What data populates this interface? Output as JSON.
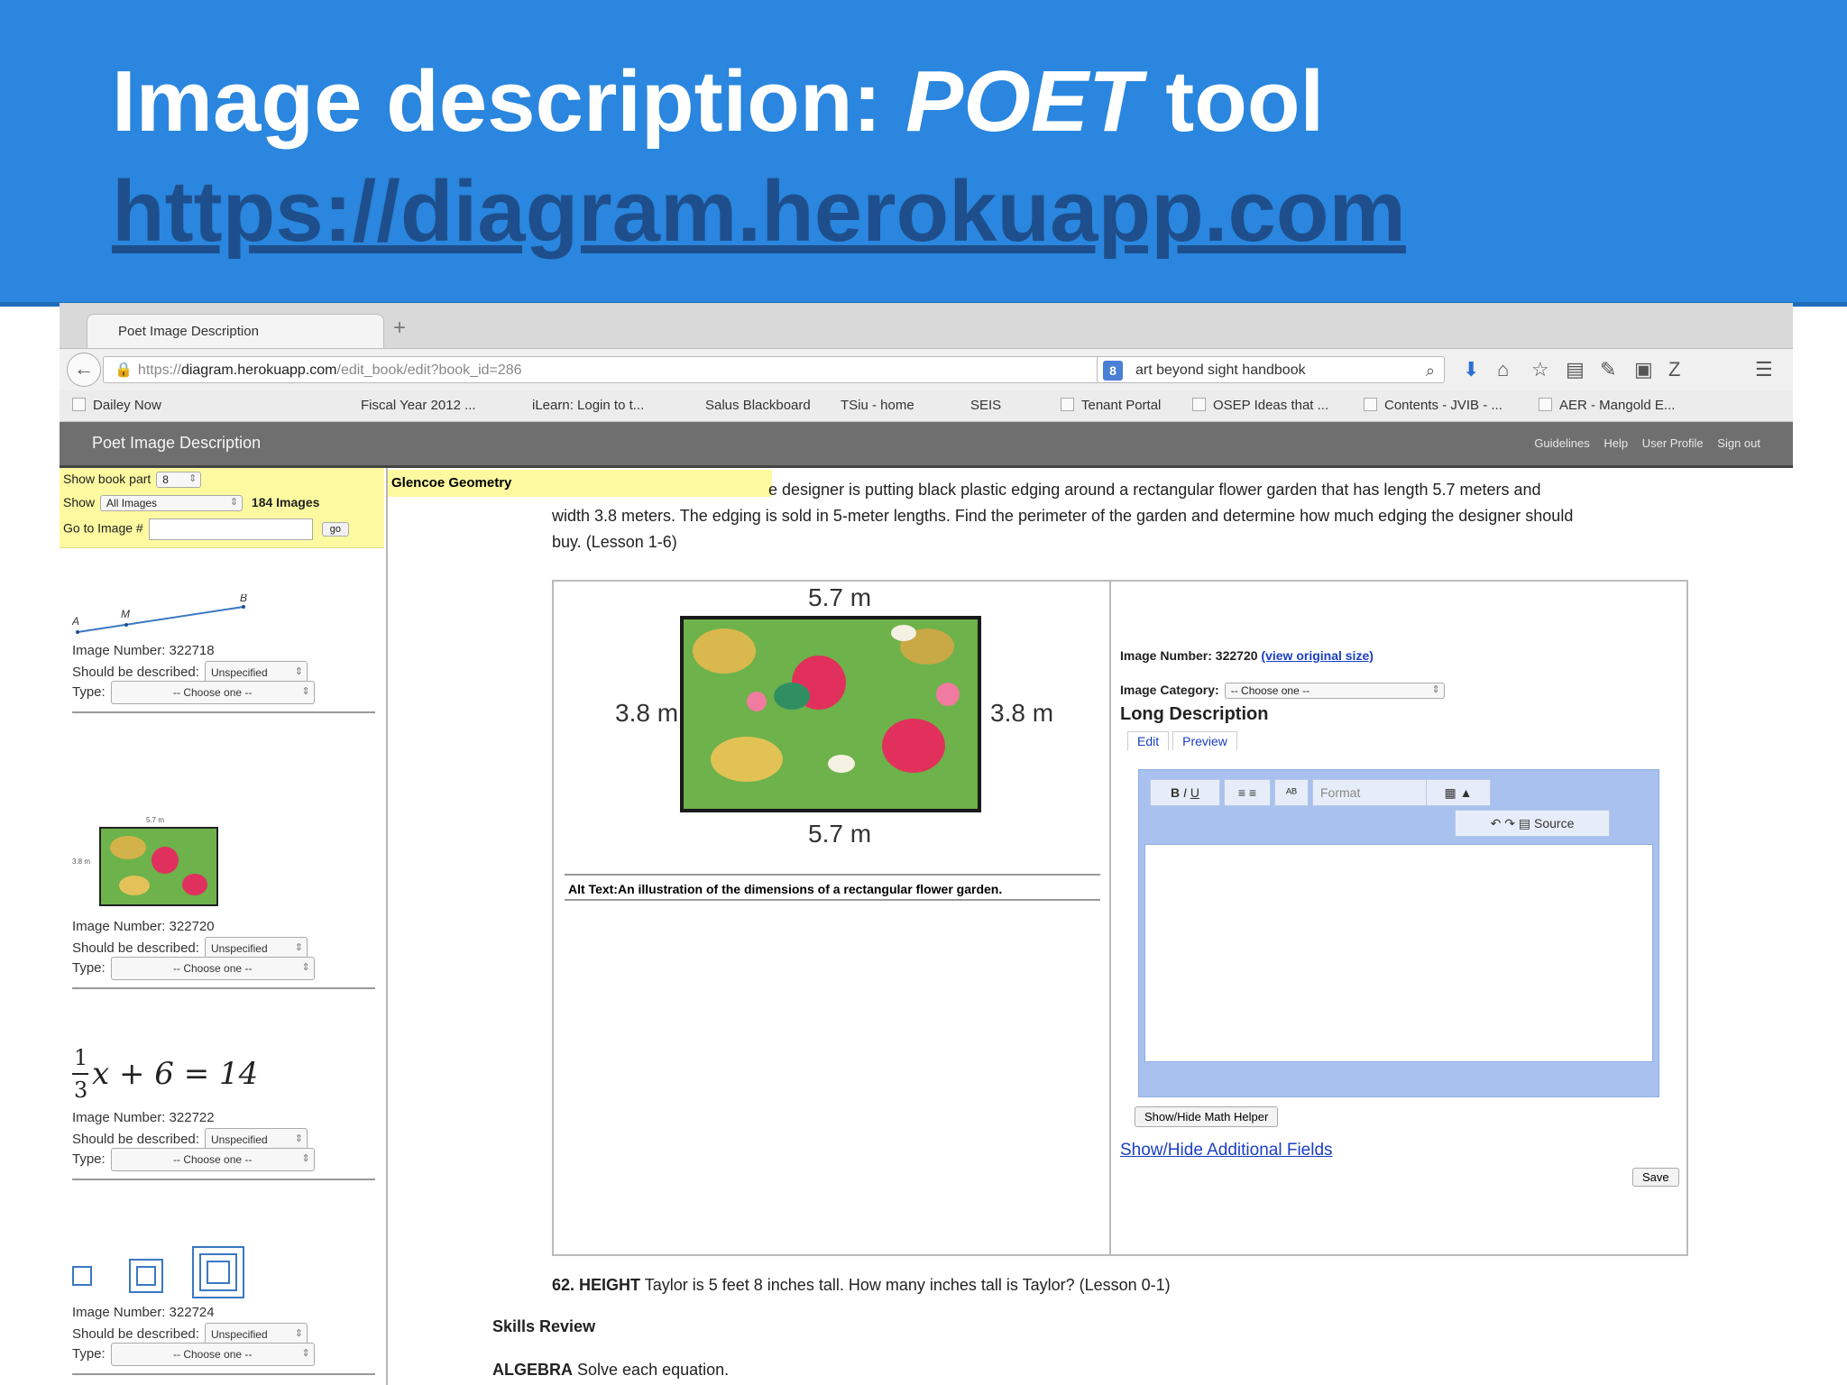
{
  "slide": {
    "title_prefix": "Image description: ",
    "title_emph": "POET",
    "title_suffix": " tool",
    "url": "https://diagram.herokuapp.com"
  },
  "browser": {
    "tab_title": "Poet Image Description",
    "url_scheme": "https://",
    "url_host": "diagram.herokuapp.com",
    "url_path": "/edit_book/edit?book_id=286",
    "search_text": "art beyond sight handbook",
    "bookmarks": [
      "Dailey Now",
      "Fiscal Year 2012 ...",
      "iLearn: Login to t...",
      "Salus Blackboard",
      "TSiu - home",
      "SEIS",
      "Tenant Portal",
      "OSEP Ideas that ...",
      "Contents - JVIB - ...",
      "AER - Mangold E..."
    ]
  },
  "app": {
    "title": "Poet Image Description",
    "links": [
      "Guidelines",
      "Help",
      "User Profile",
      "Sign out"
    ]
  },
  "sidebar": {
    "show_book_part_label": "Show book part",
    "book_part_value": "8",
    "show_label": "Show",
    "show_value": "All Images",
    "image_count": "184 Images",
    "goto_label": "Go to Image #",
    "go_label": "go",
    "number_label": "Image Number:",
    "described_label": "Should be described:",
    "type_label": "Type:",
    "described_value": "Unspecified",
    "type_value": "-- Choose one --",
    "images": [
      {
        "number": "322718",
        "points": [
          "A",
          "M",
          "B"
        ]
      },
      {
        "number": "322720",
        "dims": [
          "5.7 m",
          "3.8 m"
        ]
      },
      {
        "number": "322722",
        "eq_num": "1",
        "eq_den": "3",
        "eq_rest": "x + 6 = 14"
      },
      {
        "number": "322724"
      }
    ]
  },
  "main": {
    "book_title": "Glencoe Geometry",
    "question": "e designer is putting black plastic edging around a rectangular flower garden that has length 5.7 meters and width 3.8 meters. The edging is sold in 5-meter lengths. Find the perimeter of the garden and determine how much edging the designer should buy. (Lesson 1-6)",
    "dim_top": "5.7 m",
    "dim_bottom": "5.7 m",
    "dim_left": "3.8 m",
    "dim_right": "3.8 m",
    "alt_text": "Alt Text:An illustration of the dimensions of a rectangular flower garden.",
    "image_number_label": "Image Number: 322720",
    "view_original": "(view original size)",
    "category_label": "Image Category:",
    "category_value": "-- Choose one --",
    "long_desc_title": "Long Description",
    "tab_edit": "Edit",
    "tab_preview": "Preview",
    "format_label": "Format",
    "source_label": "Source",
    "math_helper": "Show/Hide Math Helper",
    "additional_fields": "Show/Hide Additional Fields",
    "save": "Save",
    "q62_label": "62. HEIGHT",
    "q62_text": "Taylor is 5 feet 8 inches tall. How many inches tall is Taylor? (Lesson 0-1)",
    "skills_review": "Skills Review",
    "algebra_label": "ALGEBRA",
    "algebra_text": "Solve each equation."
  },
  "colors": {
    "banner": "#2a86de",
    "url_text": "#1e4f8c",
    "highlight_yellow": "#fcf9a1",
    "app_bar": "#6f6f6f",
    "link_blue": "#1a3fc4",
    "editor_blue": "#a8c1ee"
  },
  "icons": [
    "back-arrow-icon",
    "lock-icon",
    "reload-icon",
    "search-icon",
    "download-icon",
    "home-icon",
    "star-icon",
    "bookmark-icon",
    "menu-icon"
  ]
}
